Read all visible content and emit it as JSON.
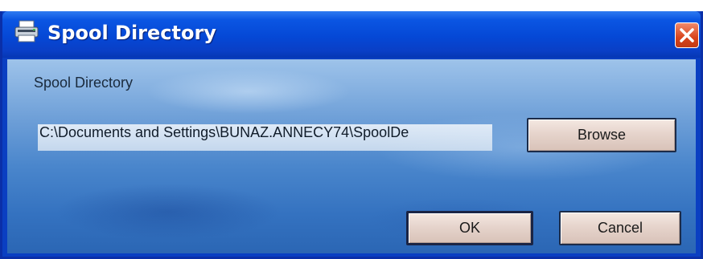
{
  "window": {
    "title": "Spool Directory",
    "title_icon": "printer-icon",
    "close_icon": "close-icon"
  },
  "form": {
    "label": "Spool Directory",
    "path_value": "C:\\Documents and Settings\\BUNAZ.ANNECY74\\SpoolDe"
  },
  "buttons": {
    "browse": "Browse",
    "ok": "OK",
    "cancel": "Cancel"
  },
  "colors": {
    "titlebar": "#0548d6",
    "close": "#d9441c",
    "button_face": "#e6d4cc",
    "client_background": "#4a86cc"
  }
}
